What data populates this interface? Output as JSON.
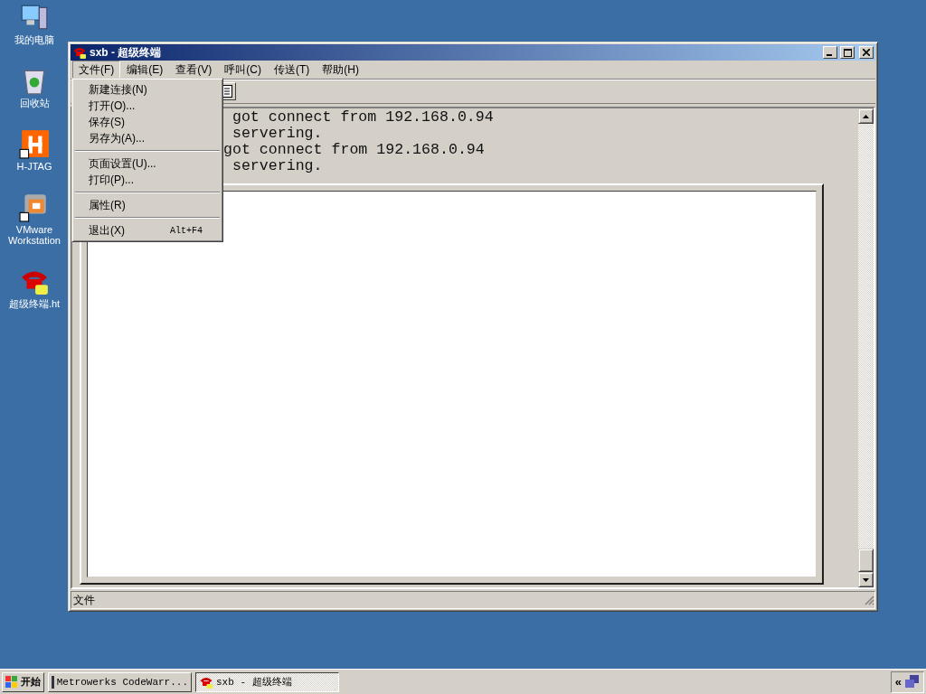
{
  "desktop_icons": [
    {
      "kind": "computer",
      "label": "我的电脑"
    },
    {
      "kind": "recycle",
      "label": "回收站"
    },
    {
      "kind": "hjtag",
      "label": "H-JTAG"
    },
    {
      "kind": "vmware",
      "label": "VMware Workstation"
    },
    {
      "kind": "phone",
      "label": "超级终端.ht"
    }
  ],
  "window": {
    "title": "sxb - 超级终端",
    "menu": [
      {
        "label": "文件(F)",
        "selected": true
      },
      {
        "label": "编辑(E)",
        "selected": false
      },
      {
        "label": "查看(V)",
        "selected": false
      },
      {
        "label": "呼叫(C)",
        "selected": false
      },
      {
        "label": "传送(T)",
        "selected": false
      },
      {
        "label": "帮助(H)",
        "selected": false
      }
    ],
    "terminal_lines": [
      " got connect from 192.168.0.94",
      " servering.",
      "got connect from 192.168.0.94",
      " servering."
    ],
    "status_bar": "文件"
  },
  "file_menu": {
    "items": [
      {
        "kind": "item",
        "label": "新建连接(N)"
      },
      {
        "kind": "item",
        "label": "打开(O)..."
      },
      {
        "kind": "item",
        "label": "保存(S)"
      },
      {
        "kind": "item",
        "label": "另存为(A)..."
      },
      {
        "kind": "separator"
      },
      {
        "kind": "item",
        "label": "页面设置(U)..."
      },
      {
        "kind": "item",
        "label": "打印(P)..."
      },
      {
        "kind": "separator"
      },
      {
        "kind": "item",
        "label": "属性(R)"
      },
      {
        "kind": "separator"
      },
      {
        "kind": "item",
        "label": "退出(X)",
        "shortcut": "Alt+F4"
      }
    ]
  },
  "taskbar": {
    "start": "开始",
    "tasks": [
      {
        "kind": "codewarrior",
        "label": "Metrowerks CodeWarr...",
        "selected": false
      },
      {
        "kind": "phone",
        "label": "sxb - 超级终端",
        "selected": true
      }
    ],
    "tray_toggle": "«"
  }
}
